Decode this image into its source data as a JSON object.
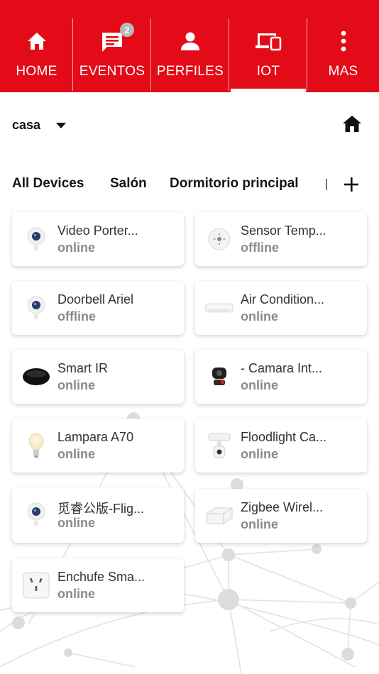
{
  "nav": {
    "items": [
      {
        "label": "HOME",
        "icon": "home-icon"
      },
      {
        "label": "EVENTOS",
        "icon": "chat-icon",
        "badge": "2"
      },
      {
        "label": "PERFILES",
        "icon": "person-icon"
      },
      {
        "label": "IOT",
        "icon": "devices-icon",
        "active": true
      },
      {
        "label": "MAS",
        "icon": "more-vertical-icon"
      }
    ],
    "color": "#e30b17"
  },
  "home_selector": {
    "value": "casa",
    "home_icon": "house-icon"
  },
  "rooms": {
    "tabs": [
      "All Devices",
      "Salón",
      "Dormitorio principal"
    ],
    "add_icon": "plus-icon"
  },
  "devices": [
    {
      "name": "Video Porter...",
      "status": "online",
      "icon": "camera-icon"
    },
    {
      "name": "Sensor Temp...",
      "status": "offline",
      "icon": "sensor-icon"
    },
    {
      "name": "Doorbell Ariel",
      "status": "offline",
      "icon": "camera-icon"
    },
    {
      "name": "Air Condition...",
      "status": "online",
      "icon": "air-conditioner-icon"
    },
    {
      "name": "Smart IR",
      "status": "online",
      "icon": "ir-remote-icon"
    },
    {
      "name": "- Camara Int...",
      "status": "online",
      "icon": "indoor-camera-icon"
    },
    {
      "name": "Lampara A70",
      "status": "online",
      "icon": "bulb-icon"
    },
    {
      "name": "Floodlight Ca...",
      "status": "online",
      "icon": "floodlight-icon"
    },
    {
      "name": "觅睿公版-Flig...",
      "status": "online",
      "icon": "camera-icon"
    },
    {
      "name": "Zigbee Wirel...",
      "status": "online",
      "icon": "gateway-icon"
    },
    {
      "name": "Enchufe Sma...",
      "status": "online",
      "icon": "plug-icon"
    }
  ]
}
